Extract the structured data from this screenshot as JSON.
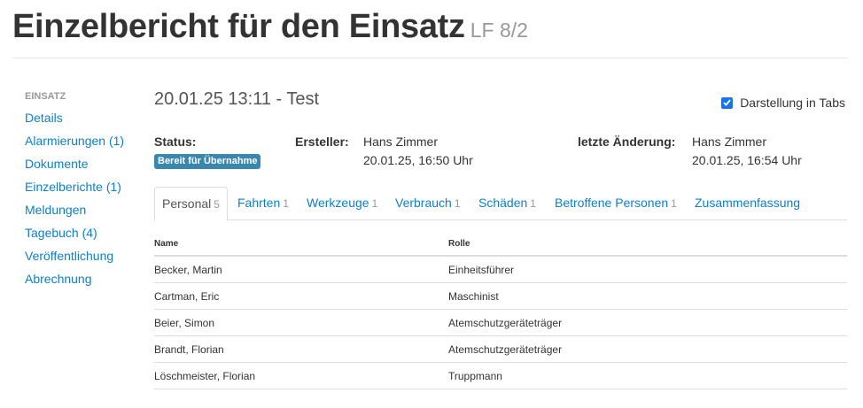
{
  "page": {
    "title": "Einzelbericht für den Einsatz",
    "subtitle": "LF 8/2"
  },
  "sidebar": {
    "heading": "EINSATZ",
    "items": [
      {
        "label": "Details"
      },
      {
        "label": "Alarmierungen (1)"
      },
      {
        "label": "Dokumente"
      },
      {
        "label": "Einzelberichte (1)"
      },
      {
        "label": "Meldungen"
      },
      {
        "label": "Tagebuch (4)"
      },
      {
        "label": "Veröffentlichung"
      },
      {
        "label": "Abrechnung"
      }
    ]
  },
  "report": {
    "title": "20.01.25 13:11 - Test",
    "tabs_toggle": {
      "label": "Darstellung in Tabs",
      "checked": true
    },
    "status_label": "Status:",
    "status_badge": "Bereit für Übernahme",
    "creator_label": "Ersteller:",
    "creator_name": "Hans Zimmer",
    "creator_date": "20.01.25, 16:50 Uhr",
    "changed_label": "letzte Änderung:",
    "changed_name": "Hans Zimmer",
    "changed_date": "20.01.25, 16:54 Uhr"
  },
  "tabs": [
    {
      "label": "Personal",
      "count": "5",
      "active": true
    },
    {
      "label": "Fahrten",
      "count": "1"
    },
    {
      "label": "Werkzeuge",
      "count": "1"
    },
    {
      "label": "Verbrauch",
      "count": "1"
    },
    {
      "label": "Schäden",
      "count": "1"
    },
    {
      "label": "Betroffene Personen",
      "count": "1"
    },
    {
      "label": "Zusammenfassung",
      "count": ""
    }
  ],
  "table": {
    "headers": [
      "Name",
      "Rolle"
    ],
    "rows": [
      [
        "Becker, Martin",
        "Einheitsführer"
      ],
      [
        "Cartman, Eric",
        "Maschinist"
      ],
      [
        "Beier, Simon",
        "Atemschutzgeräteträger"
      ],
      [
        "Brandt, Florian",
        "Atemschutzgeräteträger"
      ],
      [
        "Löschmeister, Florian",
        "Truppmann"
      ]
    ]
  },
  "colors": {
    "link": "#0e7fc7",
    "badge": "#3a87ad",
    "checkbox": "#1a73e8"
  }
}
